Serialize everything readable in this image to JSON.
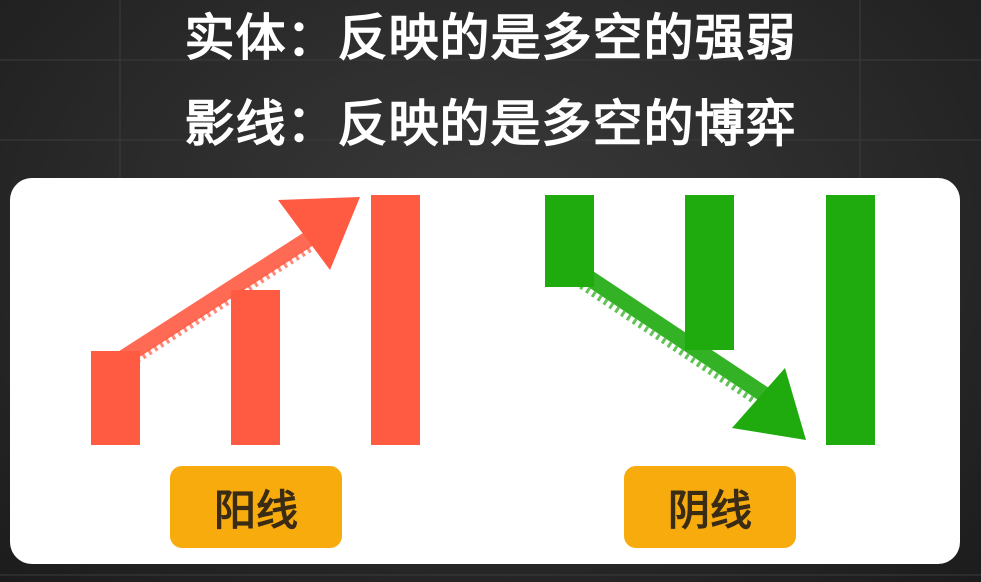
{
  "header": {
    "line1": "实体：反映的是多空的强弱",
    "line2": "影线：反映的是多空的博弈"
  },
  "labels": {
    "yang": "阳线",
    "yin": "阴线"
  },
  "colors": {
    "yang": "#ff5a42",
    "yin": "#1faa0e",
    "label_bg": "#f7ab0d",
    "panel": "#ffffff",
    "background": "#2a2a2a"
  },
  "icons": [
    "arrow-up-right-icon",
    "arrow-down-right-icon"
  ]
}
